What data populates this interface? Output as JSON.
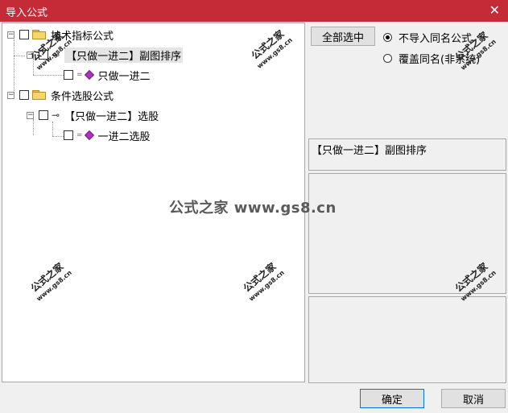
{
  "window": {
    "title": "导入公式",
    "close_glyph": "✕"
  },
  "tree": {
    "nodes": [
      {
        "label": "技术指标公式",
        "icon": "folder-icon",
        "expander": "−"
      },
      {
        "label": "【只做一进二】副图排序",
        "icon": "key-icon",
        "expander": "−",
        "selected": true
      },
      {
        "label": "只做一进二",
        "icon": "gem-icon"
      },
      {
        "label": "条件选股公式",
        "icon": "folder-icon",
        "expander": "−"
      },
      {
        "label": "【只做一进二】选股",
        "icon": "key-icon",
        "expander": "−"
      },
      {
        "label": "一进二选股",
        "icon": "gem-icon"
      }
    ]
  },
  "right_panel": {
    "select_all_label": "全部选中",
    "radio_options": [
      {
        "label": "不导入同名公式",
        "checked": true
      },
      {
        "label": "覆盖同名(非系统)",
        "checked": false
      }
    ],
    "info_text": "【只做一进二】副图排序"
  },
  "footer": {
    "ok_label": "确定",
    "cancel_label": "取消"
  },
  "watermark": {
    "stamp_text": "公式之家",
    "stamp_url": "www.gs8.cn",
    "center_text": "公式之家 www.gs8.cn"
  }
}
